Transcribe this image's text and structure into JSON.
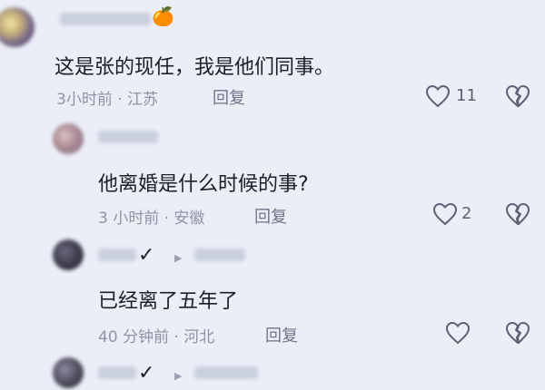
{
  "comments": [
    {
      "text": "这是张的现任，我是他们同事。",
      "meta": "3小时前 · 江苏",
      "reply_label": "回复",
      "like_count": "11"
    },
    {
      "text": "他离婚是什么时候的事?",
      "meta": "3 小时前 · 安徽",
      "reply_label": "回复",
      "like_count": "2"
    },
    {
      "text": "已经离了五年了",
      "meta": "40 分钟前 · 河北",
      "reply_label": "回复",
      "like_count": ""
    }
  ],
  "badge_emoji": "🍊",
  "verified_mark": "✓",
  "reply_arrow": "▶",
  "colors": {
    "background": "#ebeef7",
    "text": "#1d1f26",
    "meta": "#8d94a6",
    "icon": "#5b6274"
  },
  "icons": [
    "heart-icon",
    "broken-heart-icon",
    "reply-arrow-icon",
    "verified-check-icon"
  ]
}
